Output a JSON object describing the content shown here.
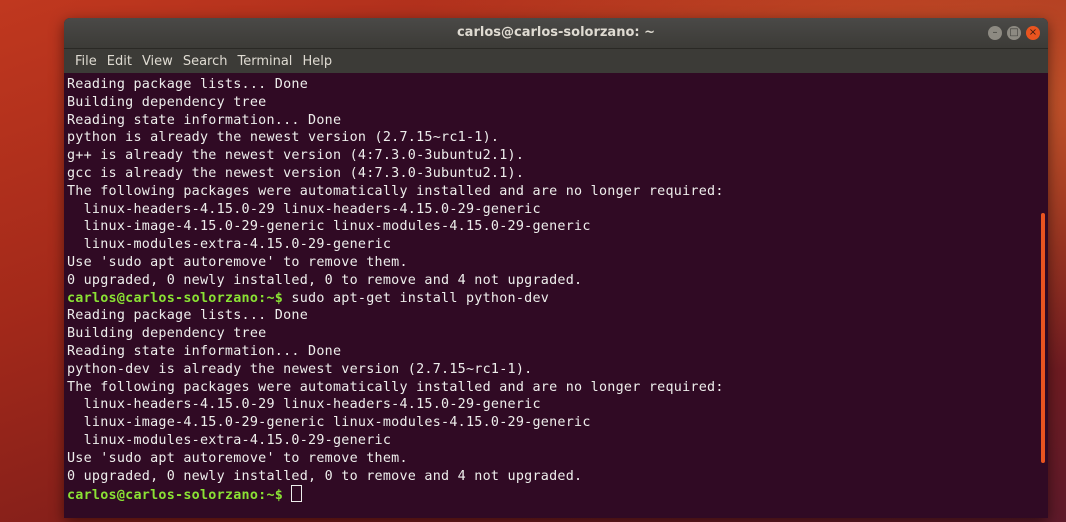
{
  "window": {
    "title": "carlos@carlos-solorzano: ~",
    "controls": [
      {
        "name": "minimize-button",
        "glyph": "–"
      },
      {
        "name": "maximize-button",
        "glyph": "□"
      },
      {
        "name": "close-button",
        "glyph": "×"
      }
    ]
  },
  "menu": [
    "File",
    "Edit",
    "View",
    "Search",
    "Terminal",
    "Help"
  ],
  "terminal": {
    "lines": [
      {
        "text": "Reading package lists... Done"
      },
      {
        "text": "Building dependency tree"
      },
      {
        "text": "Reading state information... Done"
      },
      {
        "text": "python is already the newest version (2.7.15~rc1-1)."
      },
      {
        "text": "g++ is already the newest version (4:7.3.0-3ubuntu2.1)."
      },
      {
        "text": "gcc is already the newest version (4:7.3.0-3ubuntu2.1)."
      },
      {
        "text": "The following packages were automatically installed and are no longer required:"
      },
      {
        "text": "  linux-headers-4.15.0-29 linux-headers-4.15.0-29-generic"
      },
      {
        "text": "  linux-image-4.15.0-29-generic linux-modules-4.15.0-29-generic"
      },
      {
        "text": "  linux-modules-extra-4.15.0-29-generic"
      },
      {
        "text": "Use 'sudo apt autoremove' to remove them."
      },
      {
        "text": "0 upgraded, 0 newly installed, 0 to remove and 4 not upgraded."
      },
      {
        "prompt": "carlos@carlos-solorzano:~$",
        "text": " sudo apt-get install python-dev"
      },
      {
        "text": "Reading package lists... Done"
      },
      {
        "text": "Building dependency tree"
      },
      {
        "text": "Reading state information... Done"
      },
      {
        "text": "python-dev is already the newest version (2.7.15~rc1-1)."
      },
      {
        "text": "The following packages were automatically installed and are no longer required:"
      },
      {
        "text": "  linux-headers-4.15.0-29 linux-headers-4.15.0-29-generic"
      },
      {
        "text": "  linux-image-4.15.0-29-generic linux-modules-4.15.0-29-generic"
      },
      {
        "text": "  linux-modules-extra-4.15.0-29-generic"
      },
      {
        "text": "Use 'sudo apt autoremove' to remove them."
      },
      {
        "text": "0 upgraded, 0 newly installed, 0 to remove and 4 not upgraded."
      },
      {
        "prompt": "carlos@carlos-solorzano:~$",
        "text": " ",
        "cursor": true
      }
    ]
  },
  "colors": {
    "terminal_bg": "#300a24",
    "prompt": "#8ae234",
    "text": "#eeeeec",
    "accent": "#e95420"
  }
}
